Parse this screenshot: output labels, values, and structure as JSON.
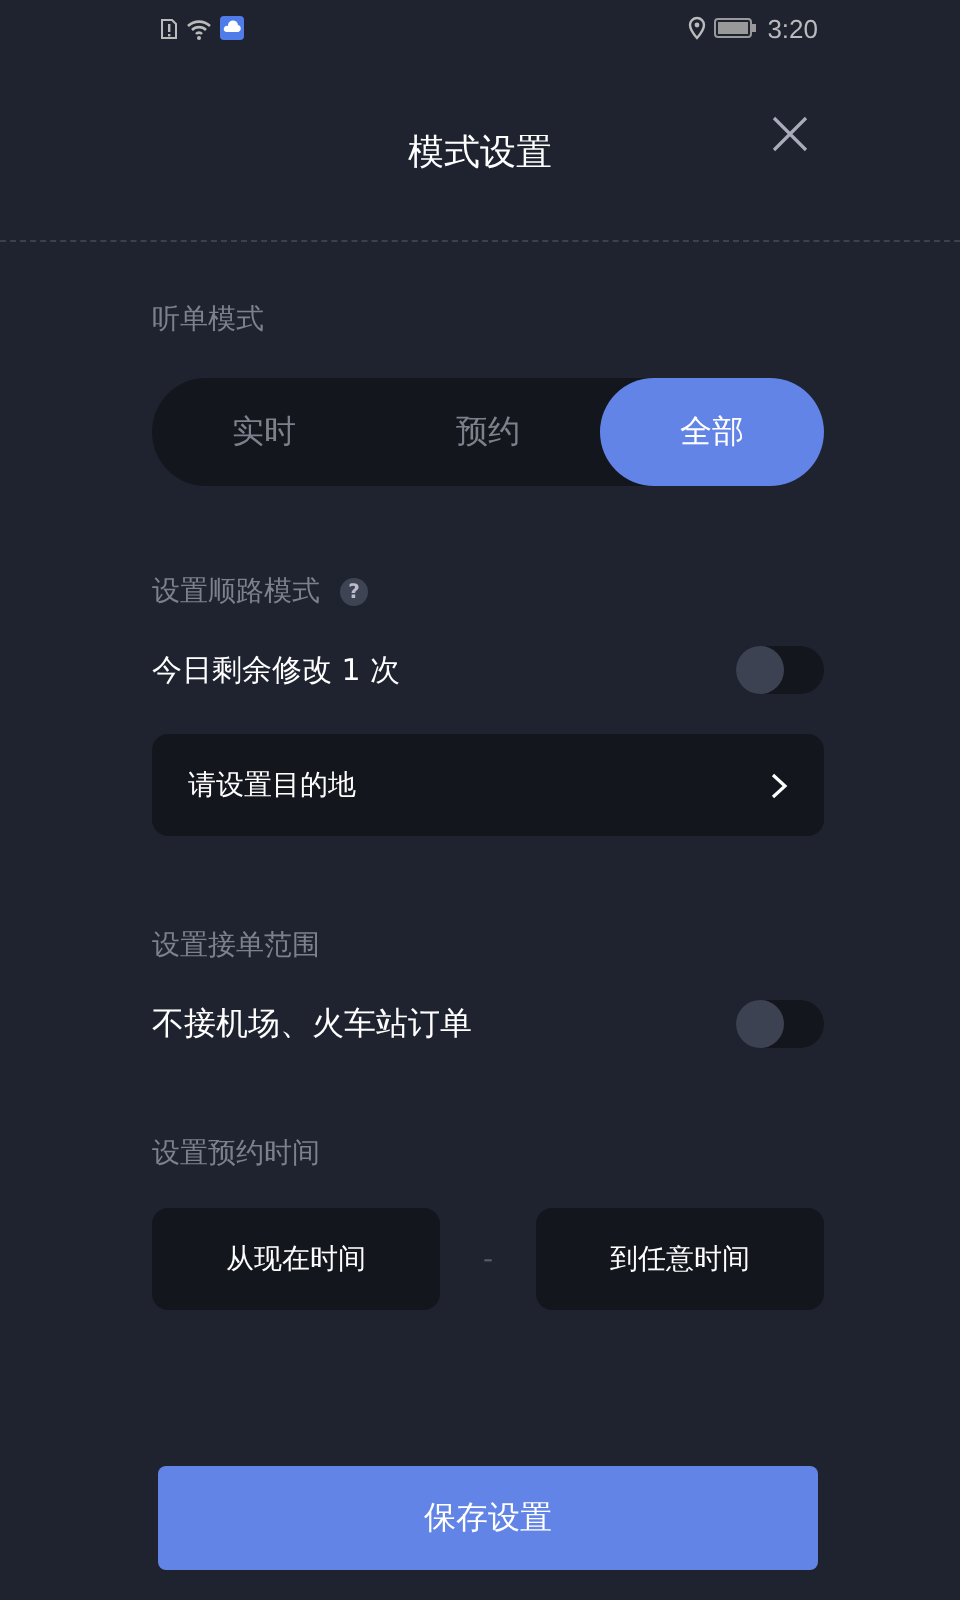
{
  "status_bar": {
    "time": "3:20"
  },
  "header": {
    "title": "模式设置"
  },
  "order_mode": {
    "label": "听单模式",
    "options": [
      {
        "label": "实时",
        "selected": false
      },
      {
        "label": "预约",
        "selected": false
      },
      {
        "label": "全部",
        "selected": true
      }
    ]
  },
  "route_mode": {
    "label": "设置顺路模式",
    "help": "?",
    "toggle": {
      "label": "今日剩余修改 1 次",
      "on": false
    },
    "destination": {
      "placeholder": "请设置目的地"
    }
  },
  "range": {
    "label": "设置接单范围",
    "toggle": {
      "label": "不接机场、火车站订单",
      "on": false
    }
  },
  "booking_time": {
    "label": "设置预约时间",
    "from": "从现在时间",
    "separator": "-",
    "to": "到任意时间"
  },
  "save_button": "保存设置"
}
